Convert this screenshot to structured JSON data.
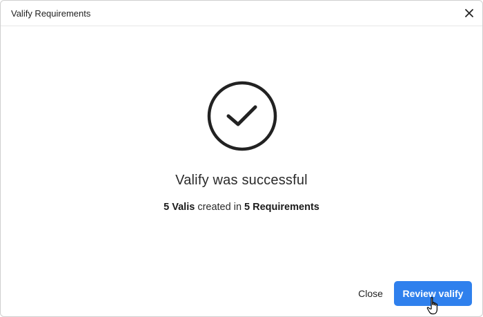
{
  "dialog": {
    "title": "Valify Requirements"
  },
  "icons": {
    "close": "close-icon",
    "success": "checkmark-circle-icon",
    "cursor": "hand-pointer-cursor-icon"
  },
  "result": {
    "heading": "Valify was successful",
    "valis_count": "5 Valis",
    "middle_text": " created in ",
    "requirements_count": "5 Requirements"
  },
  "footer": {
    "close_label": "Close",
    "review_label": "Review valify"
  },
  "colors": {
    "primary": "#2f80ed",
    "text": "#1f1f1f",
    "icon": "#222222"
  }
}
